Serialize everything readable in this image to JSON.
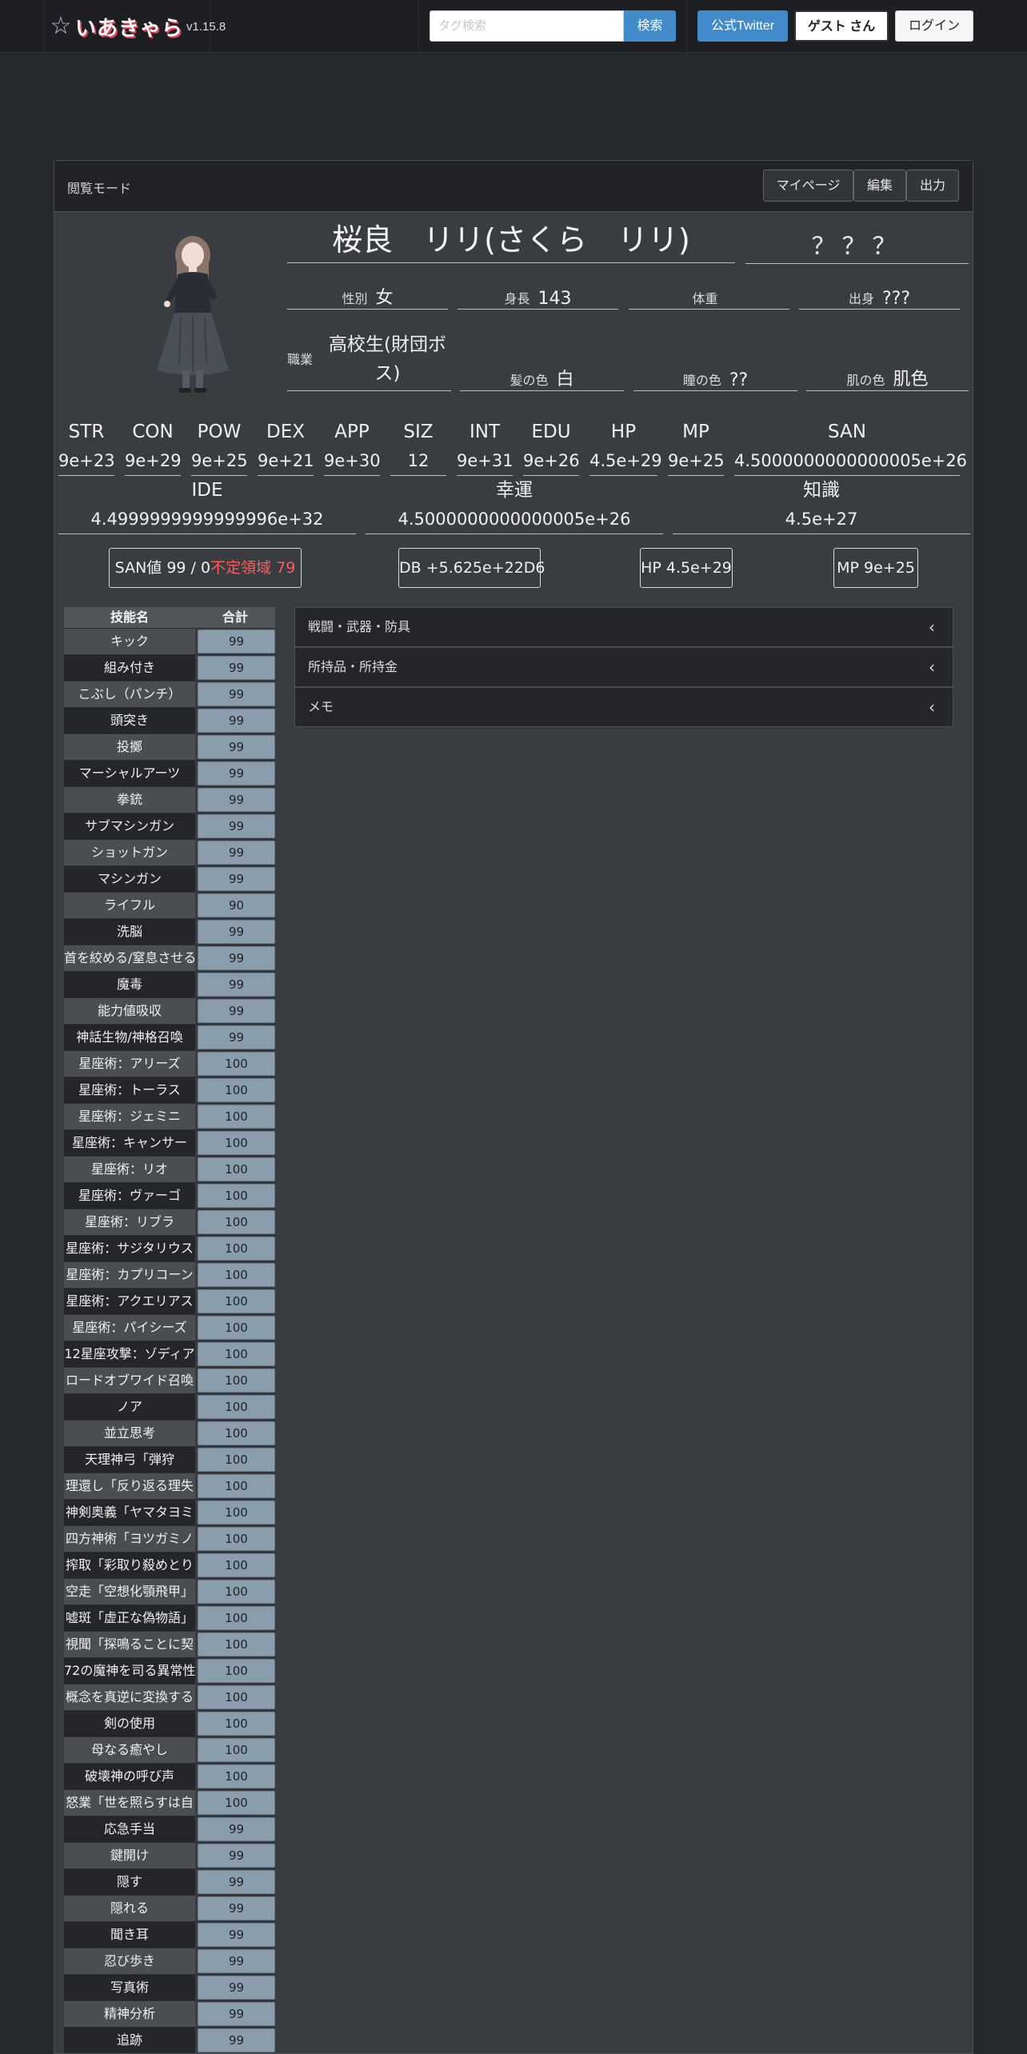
{
  "header": {
    "brand": "いあきゃら",
    "version": "v1.15.8",
    "search_placeholder": "タグ検索",
    "search_button": "検索",
    "twitter_button": "公式Twitter",
    "guest_button": "ゲスト さん",
    "login_button": "ログイン"
  },
  "panel": {
    "mode": "閲覧モード",
    "mypage": "マイページ",
    "edit": "編集",
    "export": "出力"
  },
  "profile": {
    "name": "桜良　リリ(さくら　リリ)",
    "unknown": "？？？",
    "gender_label": "性別",
    "gender": "女",
    "height_label": "身長",
    "height": "143",
    "weight_label": "体重",
    "weight": "",
    "origin_label": "出身",
    "origin": "???",
    "job_label": "職業",
    "job": "高校生(財団ボス)",
    "hair_label": "髪の色",
    "hair": "白",
    "eye_label": "瞳の色",
    "eye": "??",
    "skin_label": "肌の色",
    "skin": "肌色"
  },
  "stats": [
    {
      "label": "STR",
      "value": "9e+23"
    },
    {
      "label": "CON",
      "value": "9e+29"
    },
    {
      "label": "POW",
      "value": "9e+25"
    },
    {
      "label": "DEX",
      "value": "9e+21"
    },
    {
      "label": "APP",
      "value": "9e+30"
    },
    {
      "label": "SIZ",
      "value": "12"
    },
    {
      "label": "INT",
      "value": "9e+31"
    },
    {
      "label": "EDU",
      "value": "9e+26"
    },
    {
      "label": "HP",
      "value": "4.5e+29"
    },
    {
      "label": "MP",
      "value": "9e+25"
    },
    {
      "label": "SAN",
      "value": "4.5000000000000005e+26"
    }
  ],
  "derived": [
    {
      "label": "IDE",
      "value": "4.4999999999999996e+32"
    },
    {
      "label": "幸運",
      "value": "4.5000000000000005e+26"
    },
    {
      "label": "知識",
      "value": "4.5e+27"
    }
  ],
  "summary": {
    "san": "SAN値 99 / 0",
    "san_unstable": "不定領域 79",
    "db": "DB +5.625e+22D6",
    "hp": "HP 4.5e+29",
    "mp": "MP 9e+25"
  },
  "skills_header": {
    "name": "技能名",
    "total": "合計"
  },
  "skills": [
    {
      "name": "キック",
      "value": "99"
    },
    {
      "name": "組み付き",
      "value": "99"
    },
    {
      "name": "こぶし（パンチ）",
      "value": "99"
    },
    {
      "name": "頭突き",
      "value": "99"
    },
    {
      "name": "投擲",
      "value": "99"
    },
    {
      "name": "マーシャルアーツ",
      "value": "99"
    },
    {
      "name": "拳銃",
      "value": "99"
    },
    {
      "name": "サブマシンガン",
      "value": "99"
    },
    {
      "name": "ショットガン",
      "value": "99"
    },
    {
      "name": "マシンガン",
      "value": "99"
    },
    {
      "name": "ライフル",
      "value": "90"
    },
    {
      "name": "洗脳",
      "value": "99"
    },
    {
      "name": "首を絞める/窒息させる",
      "value": "99"
    },
    {
      "name": "魔毒",
      "value": "99"
    },
    {
      "name": "能力値吸収",
      "value": "99"
    },
    {
      "name": "神話生物/神格召喚",
      "value": "99"
    },
    {
      "name": "星座術：アリーズ",
      "value": "100"
    },
    {
      "name": "星座術：トーラス",
      "value": "100"
    },
    {
      "name": "星座術：ジェミニ",
      "value": "100"
    },
    {
      "name": "星座術：キャンサー",
      "value": "100"
    },
    {
      "name": "星座術：リオ",
      "value": "100"
    },
    {
      "name": "星座術：ヴァーゴ",
      "value": "100"
    },
    {
      "name": "星座術：リブラ",
      "value": "100"
    },
    {
      "name": "星座術：サジタリウス",
      "value": "100"
    },
    {
      "name": "星座術：カプリコーン",
      "value": "100"
    },
    {
      "name": "星座術：アクエリアス",
      "value": "100"
    },
    {
      "name": "星座術：パイシーズ",
      "value": "100"
    },
    {
      "name": "12星座攻撃：ゾディア",
      "value": "100"
    },
    {
      "name": "ロードオブワイド召喚",
      "value": "100"
    },
    {
      "name": "ノア",
      "value": "100"
    },
    {
      "name": "並立思考",
      "value": "100"
    },
    {
      "name": "天理神弓「弾狩",
      "value": "100"
    },
    {
      "name": "理還し「反り返る理失",
      "value": "100"
    },
    {
      "name": "神剣奥義「ヤマタヨミ",
      "value": "100"
    },
    {
      "name": "四方神術「ヨツガミノ",
      "value": "100"
    },
    {
      "name": "搾取「彩取り殺めとり",
      "value": "100"
    },
    {
      "name": "空走「空想化顎飛甲」",
      "value": "100"
    },
    {
      "name": "嘘斑「虚正な偽物語」",
      "value": "100"
    },
    {
      "name": "視聞「探鳴ることに契",
      "value": "100"
    },
    {
      "name": "72の魔神を司る異常性",
      "value": "100"
    },
    {
      "name": "概念を真逆に変換する",
      "value": "100"
    },
    {
      "name": "剣の使用",
      "value": "100"
    },
    {
      "name": "母なる癒やし",
      "value": "100"
    },
    {
      "name": "破壊神の呼び声",
      "value": "100"
    },
    {
      "name": "怒業「世を照らすは自",
      "value": "100"
    },
    {
      "name": "応急手当",
      "value": "99"
    },
    {
      "name": "鍵開け",
      "value": "99"
    },
    {
      "name": "隠す",
      "value": "99"
    },
    {
      "name": "隠れる",
      "value": "99"
    },
    {
      "name": "聞き耳",
      "value": "99"
    },
    {
      "name": "忍び歩き",
      "value": "99"
    },
    {
      "name": "写真術",
      "value": "99"
    },
    {
      "name": "精神分析",
      "value": "99"
    },
    {
      "name": "追跡",
      "value": "99"
    }
  ],
  "sections": [
    {
      "label": "戦闘・武器・防具"
    },
    {
      "label": "所持品・所持金"
    },
    {
      "label": "メモ"
    }
  ],
  "colors": {
    "background": "#25282c",
    "panel": "#393d42",
    "accent": "#428bca",
    "skill_value": "#8a9dad",
    "unstable": "#ff5b5b"
  },
  "icons": {
    "chevron": "chevron-left-icon",
    "logo": "star-logo-icon"
  }
}
